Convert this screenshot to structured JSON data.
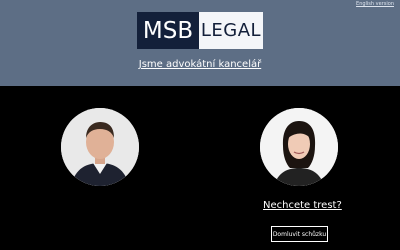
{
  "header": {
    "language_link": "English version",
    "logo": {
      "left": "MSB",
      "right": "LEGAL"
    },
    "tagline": "Jsme advokátní kancelář"
  },
  "main": {
    "question": "Nechcete trest?",
    "cta_label": "Domluvit schůzku"
  },
  "colors": {
    "header_bg": "#5d6e85",
    "logo_dark": "#13203a",
    "logo_light": "#f4f6f9",
    "main_bg": "#000000",
    "text": "#ffffff"
  }
}
